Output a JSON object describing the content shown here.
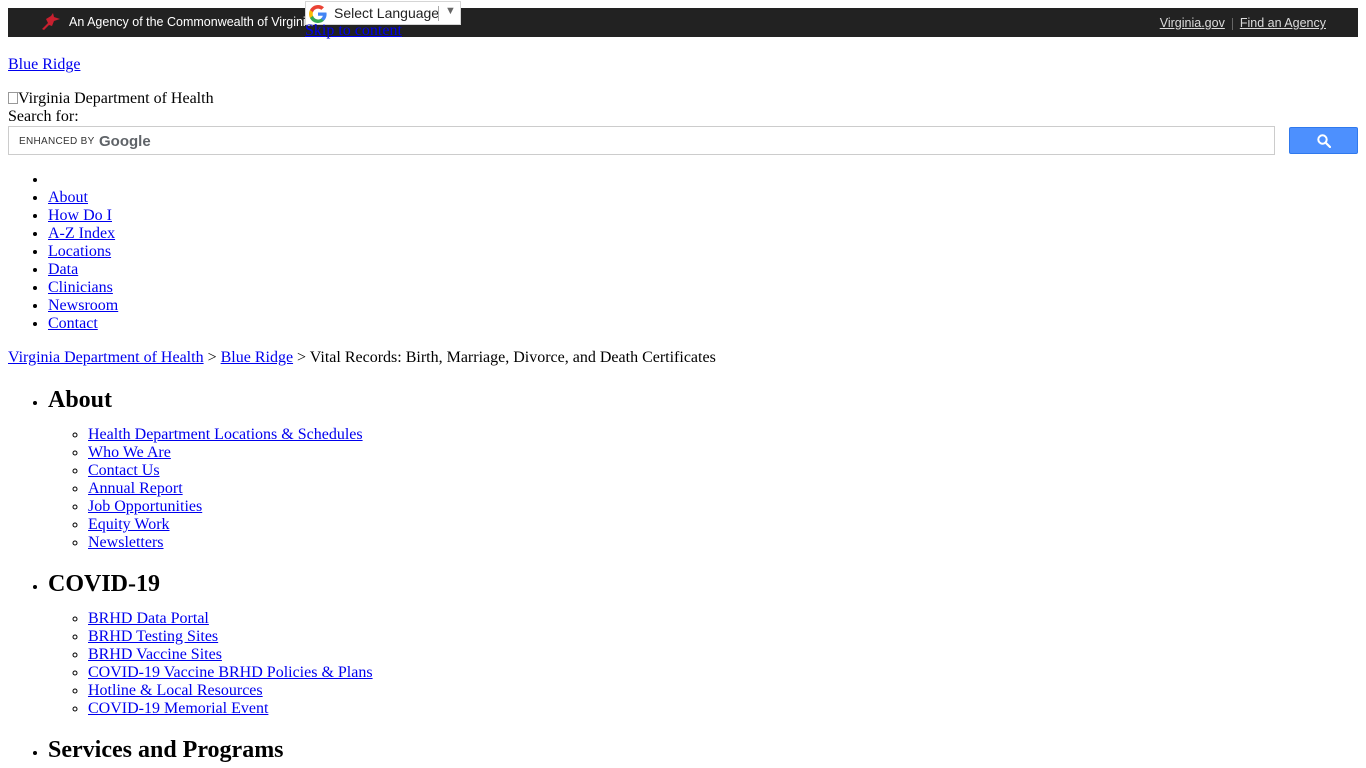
{
  "topbar": {
    "agency_text": "An Agency of the Commonwealth of Virginia",
    "links": [
      "Virginia.gov",
      "Find an Agency"
    ]
  },
  "translate": {
    "label": "Select Language",
    "caret": "▼"
  },
  "skip_link": "Skip to content",
  "site_name": "Blue Ridge",
  "logo_alt": "Virginia Department of Health",
  "search": {
    "label": "Search for:",
    "watermark_prefix": "ENHANCED BY",
    "watermark_brand": "Google",
    "value": ""
  },
  "main_nav": [
    "About",
    "How Do I",
    "A-Z Index",
    "Locations",
    "Data",
    "Clinicians",
    "Newsroom",
    "Contact"
  ],
  "breadcrumb": {
    "links": [
      "Virginia Department of Health",
      "Blue Ridge"
    ],
    "separator": ">",
    "current": "Vital Records: Birth, Marriage, Divorce, and Death Certificates"
  },
  "sections": [
    {
      "title": "About",
      "items": [
        "Health Department Locations & Schedules",
        "Who We Are",
        "Contact Us",
        "Annual Report",
        "Job Opportunities",
        "Equity Work",
        "Newsletters"
      ]
    },
    {
      "title": "COVID-19",
      "items": [
        "BRHD Data Portal",
        "BRHD Testing Sites",
        "BRHD Vaccine Sites",
        "COVID-19 Vaccine BRHD Policies & Plans",
        "Hotline & Local Resources",
        "COVID-19 Memorial Event"
      ]
    },
    {
      "title": "Services and Programs",
      "items": []
    }
  ],
  "colors": {
    "topbar": "#222222",
    "cardinal": "#c8202f",
    "search_button": "#4d90fe",
    "link": "#0000ee"
  }
}
